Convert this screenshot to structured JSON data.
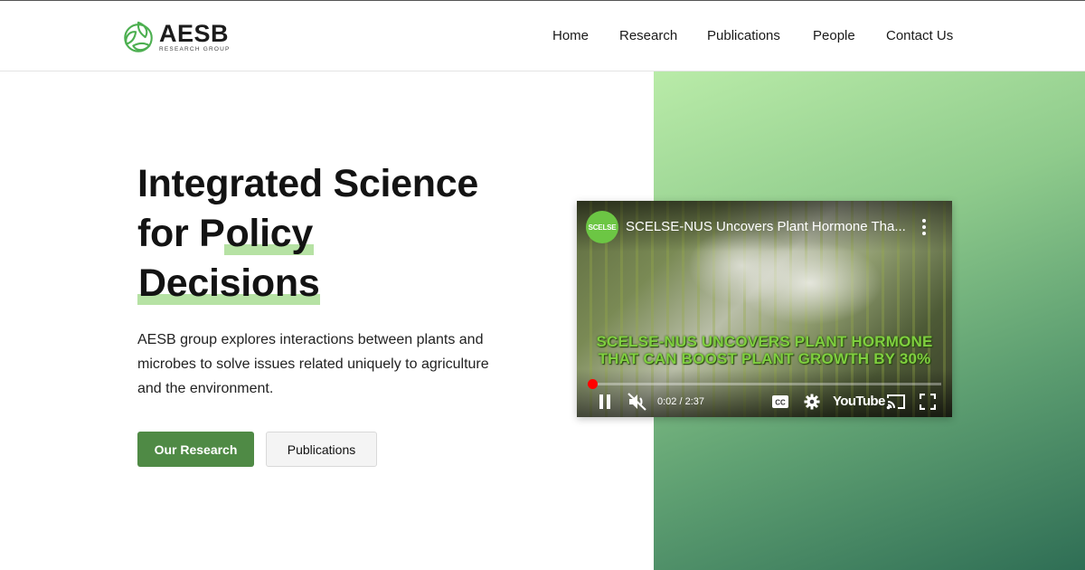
{
  "brand": {
    "name": "AESB",
    "subtitle": "RESEARCH GROUP",
    "color": "#4caf50"
  },
  "nav": {
    "items": [
      {
        "label": "Home"
      },
      {
        "label": "Research"
      },
      {
        "label": "Publications"
      },
      {
        "label": "People"
      },
      {
        "label": "Contact Us"
      }
    ]
  },
  "hero": {
    "title_line1": "Integrated Science",
    "title_line2_pre": "for P",
    "title_line2_highlight": "olicy",
    "title_line3": "Decisions",
    "description": "AESB group explores interactions between plants and microbes to solve issues related uniquely to agriculture and the environment.",
    "primary_button": "Our Research",
    "secondary_button": "Publications",
    "highlight_color": "#b6e2a4",
    "primary_color": "#4f8a45"
  },
  "video": {
    "channel_badge": "SCELSE",
    "title": "SCELSE-NUS Uncovers Plant Hormone Tha...",
    "caption_line1": "SCELSE-NUS UNCOVERS PLANT HORMONE",
    "caption_line2": "THAT CAN BOOST PLANT GROWTH BY 30%",
    "time": "0:02 / 2:37",
    "progress_fraction": 0.013,
    "youtube_label": "YouTube",
    "icons": [
      "pause-icon",
      "mute-icon",
      "captions-icon",
      "settings-icon",
      "cast-icon",
      "fullscreen-icon",
      "more-vert-icon"
    ]
  }
}
